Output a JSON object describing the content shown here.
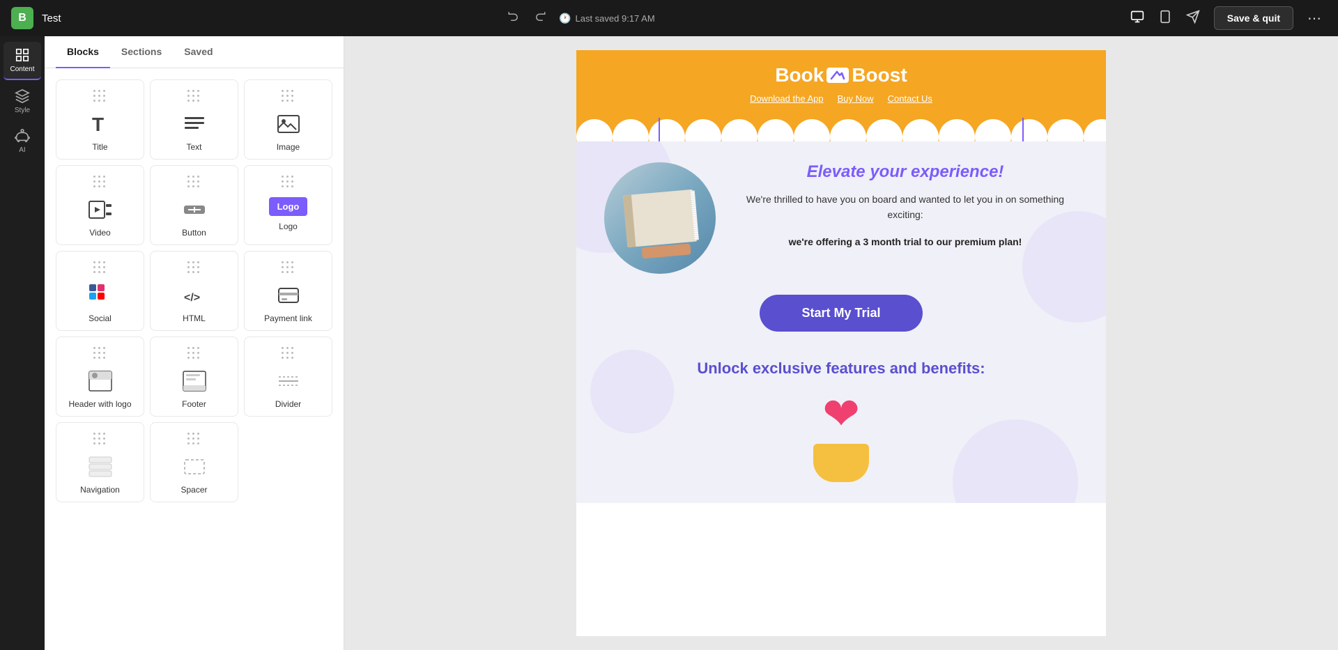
{
  "topbar": {
    "logo_letter": "B",
    "title": "Test",
    "undo_label": "↺",
    "redo_label": "↻",
    "saved_text": "Last saved 9:17 AM",
    "save_quit_label": "Save & quit",
    "more_label": "⋯"
  },
  "sidebar": {
    "items": [
      {
        "id": "content",
        "label": "Content",
        "active": true
      },
      {
        "id": "style",
        "label": "Style",
        "active": false
      },
      {
        "id": "ai",
        "label": "AI",
        "active": false
      }
    ]
  },
  "blocks_panel": {
    "tabs": [
      {
        "id": "blocks",
        "label": "Blocks",
        "active": true
      },
      {
        "id": "sections",
        "label": "Sections",
        "active": false
      },
      {
        "id": "saved",
        "label": "Saved",
        "active": false
      }
    ],
    "blocks": [
      {
        "id": "title",
        "label": "Title",
        "icon": "T"
      },
      {
        "id": "text",
        "label": "Text",
        "icon": "≡"
      },
      {
        "id": "image",
        "label": "Image",
        "icon": "🖼"
      },
      {
        "id": "video",
        "label": "Video",
        "icon": "▶"
      },
      {
        "id": "button",
        "label": "Button",
        "icon": "btn"
      },
      {
        "id": "logo",
        "label": "Logo",
        "icon": "Logo"
      },
      {
        "id": "social",
        "label": "Social",
        "icon": "soc"
      },
      {
        "id": "html",
        "label": "HTML",
        "icon": "</>"
      },
      {
        "id": "payment",
        "label": "Payment link",
        "icon": "pay"
      },
      {
        "id": "header",
        "label": "Header with logo",
        "icon": "hdr"
      },
      {
        "id": "footer",
        "label": "Footer",
        "icon": "ftr"
      },
      {
        "id": "divider",
        "label": "Divider",
        "icon": "div"
      },
      {
        "id": "navigation",
        "label": "Navigation",
        "icon": "nav"
      },
      {
        "id": "spacer",
        "label": "Spacer",
        "icon": "spa"
      }
    ]
  },
  "email": {
    "header": {
      "logo_text_1": "Book",
      "logo_icon": "↗",
      "logo_text_2": "Boost",
      "nav_items": [
        {
          "label": "Download the App",
          "href": "#"
        },
        {
          "label": "Buy Now",
          "href": "#"
        },
        {
          "label": "Contact Us",
          "href": "#"
        }
      ]
    },
    "hero": {
      "headline": "Elevate your experience!",
      "body_text": "We're thrilled to have you on board and wanted to let you in on something exciting:",
      "offer_text": "we're offering a 3 month trial to our premium plan!",
      "cta_label": "Start My Trial"
    },
    "benefits": {
      "title": "Unlock exclusive features and benefits:"
    }
  }
}
